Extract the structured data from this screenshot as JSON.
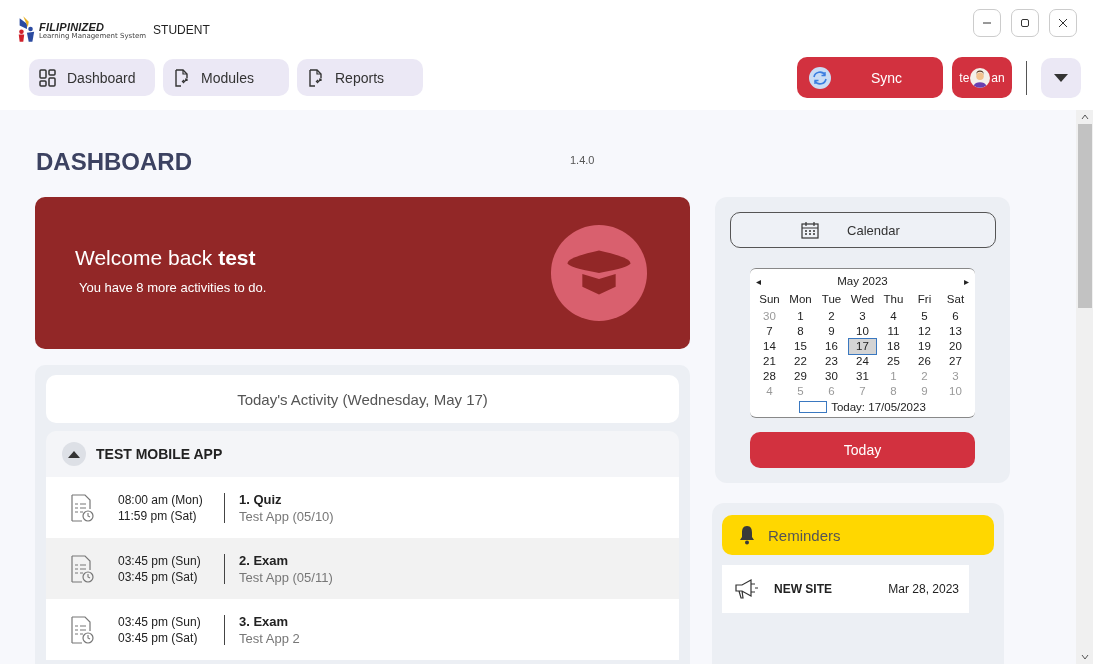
{
  "app": {
    "brand": "FILIPINIZED",
    "brand_sub": "Learning Management System",
    "product": "STUDENT"
  },
  "nav": [
    {
      "label": "Dashboard",
      "selected": false
    },
    {
      "label": "Modules",
      "selected": false
    },
    {
      "label": "Reports",
      "selected": false
    }
  ],
  "sync_button": {
    "label": "Sync"
  },
  "user_button": {
    "text_left": "te",
    "text_right": "an"
  },
  "page": {
    "title": "DASHBOARD",
    "version": "1.4.0"
  },
  "welcome": {
    "greeting": "Welcome back **test**",
    "message": "You have 8 more activities to do."
  },
  "activity": {
    "title": "Today's Activity (Wednesday, May 17)",
    "groups": [
      {
        "name": "TEST MOBILE APP",
        "expanded": true,
        "items": [
          {
            "start": "08:00 am (Mon)",
            "end": "11:59 pm (Sat)",
            "title": "1. Quiz",
            "subtitle": "Test App (05/10)"
          },
          {
            "start": "03:45 pm (Sun)",
            "end": "03:45 pm (Sat)",
            "title": "2. Exam",
            "subtitle": "Test App (05/11)"
          },
          {
            "start": "03:45 pm (Sun)",
            "end": "03:45 pm (Sat)",
            "title": "3. Exam",
            "subtitle": "Test App 2"
          }
        ]
      }
    ]
  },
  "calendar": {
    "button": "Calendar",
    "prev": "◂",
    "next": "▸",
    "month": "May 2023",
    "weekdays": [
      "Sun",
      "Mon",
      "Tue",
      "Wed",
      "Thu",
      "Fri",
      "Sat"
    ],
    "weeks": [
      [
        {
          "day": "30",
          "outside": true,
          "selected": false
        },
        {
          "day": "1",
          "outside": false,
          "selected": false
        },
        {
          "day": "2",
          "outside": false,
          "selected": false
        },
        {
          "day": "3",
          "outside": false,
          "selected": false
        },
        {
          "day": "4",
          "outside": false,
          "selected": false
        },
        {
          "day": "5",
          "outside": false,
          "selected": false
        },
        {
          "day": "6",
          "outside": false,
          "selected": false
        }
      ],
      [
        {
          "day": "7",
          "outside": false,
          "selected": false
        },
        {
          "day": "8",
          "outside": false,
          "selected": false
        },
        {
          "day": "9",
          "outside": false,
          "selected": false
        },
        {
          "day": "10",
          "outside": false,
          "selected": false
        },
        {
          "day": "11",
          "outside": false,
          "selected": false
        },
        {
          "day": "12",
          "outside": false,
          "selected": false
        },
        {
          "day": "13",
          "outside": false,
          "selected": false
        }
      ],
      [
        {
          "day": "14",
          "outside": false,
          "selected": false
        },
        {
          "day": "15",
          "outside": false,
          "selected": false
        },
        {
          "day": "16",
          "outside": false,
          "selected": false
        },
        {
          "day": "17",
          "outside": false,
          "selected": true
        },
        {
          "day": "18",
          "outside": false,
          "selected": false
        },
        {
          "day": "19",
          "outside": false,
          "selected": false
        },
        {
          "day": "20",
          "outside": false,
          "selected": false
        }
      ],
      [
        {
          "day": "21",
          "outside": false,
          "selected": false
        },
        {
          "day": "22",
          "outside": false,
          "selected": false
        },
        {
          "day": "23",
          "outside": false,
          "selected": false
        },
        {
          "day": "24",
          "outside": false,
          "selected": false
        },
        {
          "day": "25",
          "outside": false,
          "selected": false
        },
        {
          "day": "26",
          "outside": false,
          "selected": false
        },
        {
          "day": "27",
          "outside": false,
          "selected": false
        }
      ],
      [
        {
          "day": "28",
          "outside": false,
          "selected": false
        },
        {
          "day": "29",
          "outside": false,
          "selected": false
        },
        {
          "day": "30",
          "outside": false,
          "selected": false
        },
        {
          "day": "31",
          "outside": false,
          "selected": false
        },
        {
          "day": "1",
          "outside": true,
          "selected": false
        },
        {
          "day": "2",
          "outside": true,
          "selected": false
        },
        {
          "day": "3",
          "outside": true,
          "selected": false
        }
      ],
      [
        {
          "day": "4",
          "outside": true,
          "selected": false
        },
        {
          "day": "5",
          "outside": true,
          "selected": false
        },
        {
          "day": "6",
          "outside": true,
          "selected": false
        },
        {
          "day": "7",
          "outside": true,
          "selected": false
        },
        {
          "day": "8",
          "outside": true,
          "selected": false
        },
        {
          "day": "9",
          "outside": true,
          "selected": false
        },
        {
          "day": "10",
          "outside": true,
          "selected": false
        }
      ]
    ],
    "today_label": "Today: 17/05/2023",
    "today_button": "Today"
  },
  "reminders": {
    "title": "Reminders",
    "items": [
      {
        "title": "NEW SITE",
        "date": "Mar 28, 2023"
      }
    ]
  }
}
